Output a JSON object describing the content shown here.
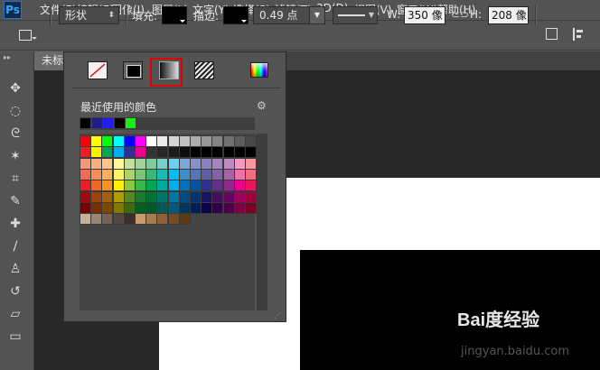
{
  "app": {
    "logo": "Ps"
  },
  "menu": [
    "文件(F)",
    "编辑(E)",
    "图像(I)",
    "图层(L)",
    "文字(Y)",
    "选择(S)",
    "滤镜(T)",
    "3D(D)",
    "视图(V)",
    "窗口(W)",
    "帮助(H)"
  ],
  "options": {
    "mode_select": "形状",
    "fill_label": "填充:",
    "stroke_label": "描边:",
    "stroke_width": "0.49 点",
    "w_label": "W:",
    "w_value": "350 像",
    "h_label": "H:",
    "h_value": "208 像"
  },
  "document": {
    "tab_title": "未标"
  },
  "popup": {
    "recent_label": "最近使用的颜色",
    "fill_types": [
      "no-color",
      "solid-color",
      "gradient",
      "pattern"
    ],
    "selected_fill_type": "gradient",
    "recent_colors": [
      "#000000",
      "#1c1c8c",
      "#1f1ff0",
      "#000000",
      "#14f014"
    ],
    "swatch_rows": [
      [
        "#ff0000",
        "#ffff00",
        "#00ff00",
        "#00ffff",
        "#0000ff",
        "#ff00ff",
        "#ffffff",
        "#ebebeb",
        "#d6d6d6",
        "#c2c2c2",
        "#adadad",
        "#999999",
        "#858585",
        "#707070",
        "#5c5c5c",
        "#474747"
      ],
      [
        "#ee1c24",
        "#fff200",
        "#00a651",
        "#00aeef",
        "#2e3192",
        "#ec008c",
        "#333333",
        "#262626",
        "#1a1a1a",
        "#0d0d0d",
        "#000000",
        "#000000",
        "#000000",
        "#000000",
        "#000000",
        "#000000"
      ],
      [
        "#f7977a",
        "#f9ad81",
        "#fdc68a",
        "#fff79a",
        "#c4df9b",
        "#a2d39c",
        "#82ca9d",
        "#7bcdc8",
        "#6ecff6",
        "#7ea7d8",
        "#8493ca",
        "#8882be",
        "#a187be",
        "#bc8cbf",
        "#f49ac2",
        "#f6989d"
      ],
      [
        "#f26c4f",
        "#f68e55",
        "#fbaf5c",
        "#fff467",
        "#acd372",
        "#7cc576",
        "#3bb878",
        "#1abbb4",
        "#00bff3",
        "#438cca",
        "#5574b9",
        "#605ca8",
        "#855fa8",
        "#a763a8",
        "#f06ea9",
        "#f26d7d"
      ],
      [
        "#ed1c24",
        "#f26522",
        "#f7941d",
        "#fff200",
        "#8dc73f",
        "#39b54a",
        "#00a651",
        "#00a99d",
        "#00aeef",
        "#0072bc",
        "#0054a6",
        "#2e3192",
        "#662d91",
        "#92278f",
        "#ec008c",
        "#ed145b"
      ],
      [
        "#9e0b0f",
        "#a0410d",
        "#a36209",
        "#aba000",
        "#598527",
        "#1a7b30",
        "#007236",
        "#00746b",
        "#0076a3",
        "#004b80",
        "#003471",
        "#1b1464",
        "#440e62",
        "#630460",
        "#9e005d",
        "#9e0039"
      ],
      [
        "#790000",
        "#7b2e00",
        "#7d4900",
        "#827b00",
        "#406618",
        "#005e20",
        "#005826",
        "#005952",
        "#005b7f",
        "#003663",
        "#002157",
        "#0d004c",
        "#32004b",
        "#4b0049",
        "#7b0046",
        "#7a0026"
      ],
      [
        "#c7b299",
        "#998675",
        "#736357",
        "#534741",
        "#37302d",
        "#c69c6d",
        "#a67c52",
        "#8c6239",
        "#754c24",
        "#603913"
      ]
    ]
  },
  "toolbar": [
    "move-tool",
    "marquee-tool",
    "lasso-tool",
    "magic-wand-tool",
    "crop-tool",
    "eyedropper-tool",
    "healing-tool",
    "brush-tool",
    "stamp-tool",
    "history-brush-tool",
    "eraser-tool",
    "gradient-tool"
  ],
  "watermark": {
    "logo": "Bai度经验",
    "url": "jingyan.baidu.com"
  }
}
